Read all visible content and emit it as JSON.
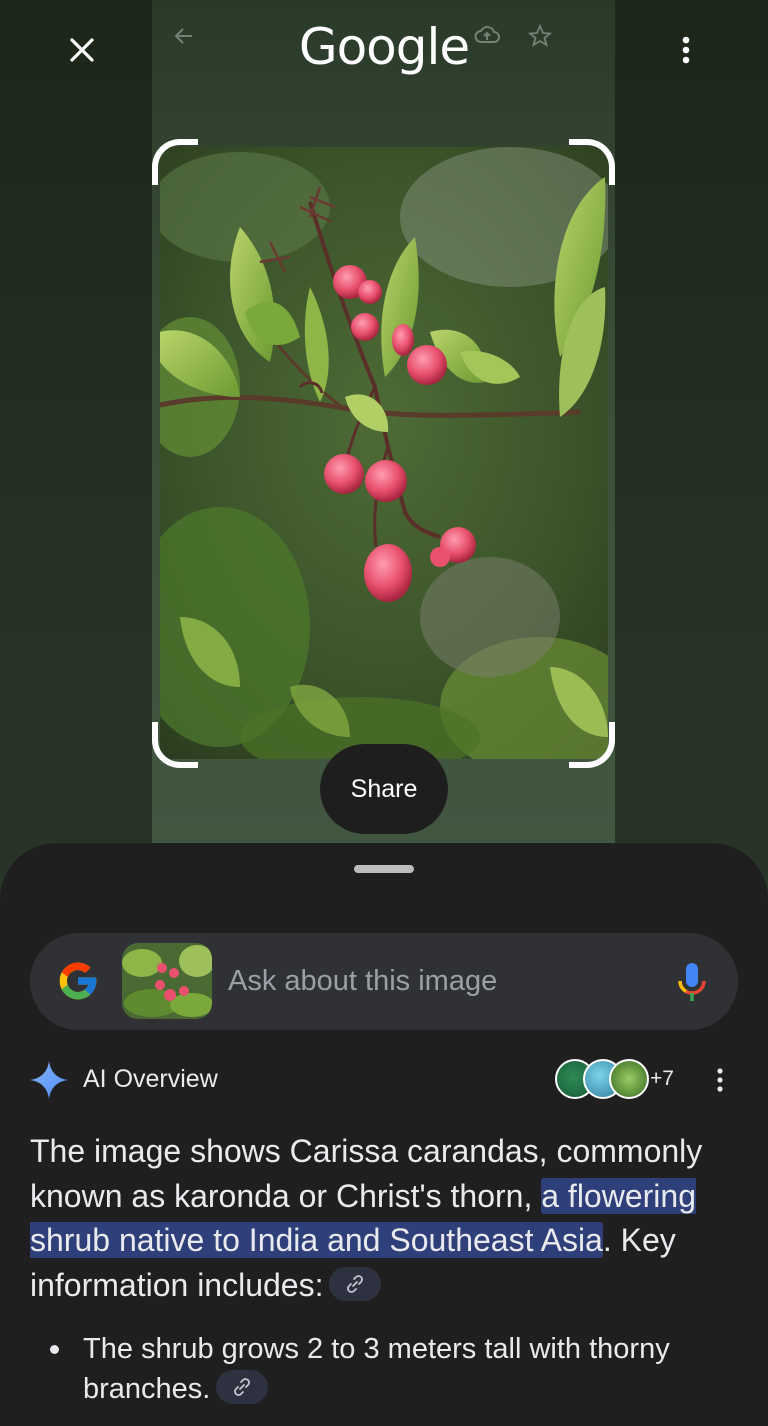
{
  "header": {
    "brand": "Google",
    "close_icon": "close-icon",
    "more_icon": "more-vert-icon"
  },
  "capture": {
    "share_label": "Share"
  },
  "search": {
    "placeholder": "Ask about this image",
    "logo_icon": "google-g-icon",
    "mic_icon": "mic-icon"
  },
  "ai_overview": {
    "title": "AI Overview",
    "source_count": "+7",
    "text_before": "The image shows Carissa carandas, commonly known as karonda or Christ's thorn, ",
    "text_highlight": "a flowering shrub native to India and Southeast Asia",
    "text_after": ". Key information includes:",
    "bullets": [
      {
        "text": "The shrub grows 2 to 3 meters tall with thorny branches."
      }
    ]
  },
  "colors": {
    "sheet": "#1f1f1f",
    "search_bar": "#303134",
    "highlight": "#2f3f7a",
    "text": "#e8eaed"
  }
}
